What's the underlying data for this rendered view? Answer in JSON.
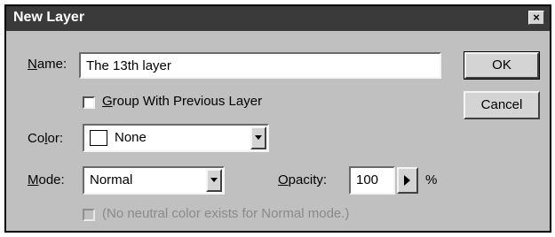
{
  "dialog": {
    "title": "New Layer",
    "close_glyph": "×"
  },
  "name_field": {
    "label": "Name:",
    "value": "The 13th layer"
  },
  "group_checkbox": {
    "label": "Group With Previous Layer",
    "checked": false
  },
  "color_select": {
    "label": "Color:",
    "value": "None",
    "swatch_color": "#ffffff"
  },
  "mode_select": {
    "label": "Mode:",
    "value": "Normal"
  },
  "opacity": {
    "label": "Opacity:",
    "value": "100",
    "unit": "%"
  },
  "neutral_checkbox": {
    "label": "(No neutral color exists for Normal mode.)",
    "checked": false,
    "disabled": true
  },
  "buttons": {
    "ok": "OK",
    "cancel": "Cancel"
  },
  "colors": {
    "dialog_bg": "#c0c0c0",
    "titlebar_bg": "#3a3a3a",
    "title_text": "#ffffff",
    "disabled_text": "#8a8a8a"
  }
}
